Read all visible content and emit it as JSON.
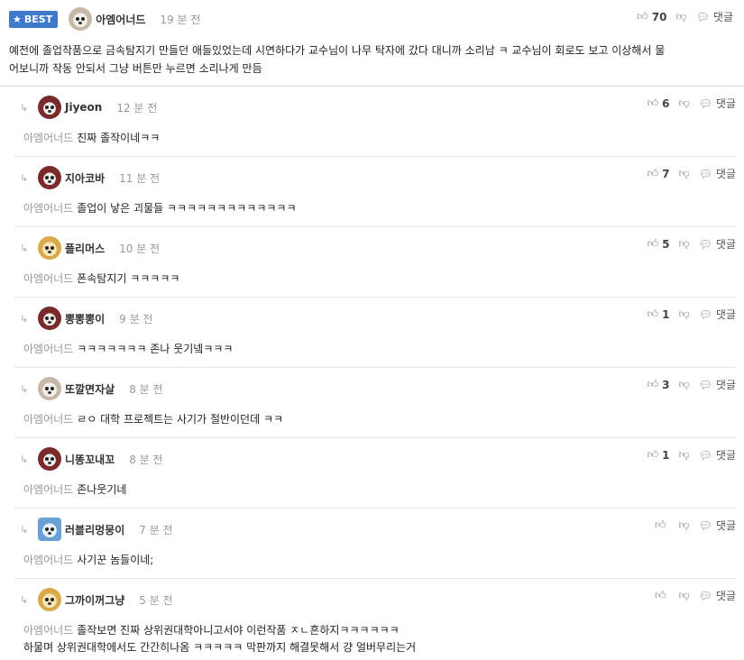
{
  "best": {
    "badge_label": "BEST",
    "nick": "아엠어너드",
    "time": "19 분 전",
    "likes": "70",
    "reply_label": "댓글",
    "text_line1": "예전에 졸업작품으로 금속탐지기 만들던 애들있었는데 시연하다가 교수님이 나무 탁자에 갔다 대니까 소리남 ㅋ 교수님이 회로도 보고 이상해서 물",
    "text_line2": "어보니까 작동 안되서 그냥 버튼만 누르면 소리나게 만듬"
  },
  "replies": [
    {
      "nick": "Jiyeon",
      "time": "12 분 전",
      "likes": "6",
      "reply_label": "댓글",
      "mention": "아엠어너드",
      "text": "진짜 졸작이네ㅋㅋ",
      "text2": "",
      "avatar": "dog-dark"
    },
    {
      "nick": "지아코바",
      "time": "11 분 전",
      "likes": "7",
      "reply_label": "댓글",
      "mention": "아엠어너드",
      "text": "졸업이 낳은 괴물들 ㅋㅋㅋㅋㅋㅋㅋㅋㅋㅋㅋㅋㅋ",
      "text2": "",
      "avatar": "dog-dark"
    },
    {
      "nick": "플리머스",
      "time": "10 분 전",
      "likes": "5",
      "reply_label": "댓글",
      "mention": "아엠어너드",
      "text": "폰속탐지기 ㅋㅋㅋㅋㅋ",
      "text2": "",
      "avatar": "dog-yellow"
    },
    {
      "nick": "뽕뽕뽕이",
      "time": "9 분 전",
      "likes": "1",
      "reply_label": "댓글",
      "mention": "아엠어너드",
      "text": "ㅋㅋㅋㅋㅋㅋㅋ 존나 웃기넼ㅋㅋㅋ",
      "text2": "",
      "avatar": "dog-dark"
    },
    {
      "nick": "또깔면자살",
      "time": "8 분 전",
      "likes": "3",
      "reply_label": "댓글",
      "mention": "아엠어너드",
      "text": "ㄹㅇ 대학 프로젝트는 사기가 절반이던데 ㅋㅋ",
      "text2": "",
      "avatar": "dog-white"
    },
    {
      "nick": "니똥꼬내꼬",
      "time": "8 분 전",
      "likes": "1",
      "reply_label": "댓글",
      "mention": "아엠어너드",
      "text": "존나웃기네",
      "text2": "",
      "avatar": "dog-dark"
    },
    {
      "nick": "러블리멍뭉이",
      "time": "7 분 전",
      "likes": "",
      "reply_label": "댓글",
      "mention": "아엠어너드",
      "text": "사기꾼 놈들이네;",
      "text2": "",
      "avatar": "dog-blue"
    },
    {
      "nick": "그까이꺼그냥",
      "time": "5 분 전",
      "likes": "",
      "reply_label": "댓글",
      "mention": "아엠어너드",
      "text": "졸작보면 진짜 상위권대학아니고서야 이런작품 ㅈㄴ흔하지ㅋㅋㅋㅋㅋㅋ",
      "text2": "하물며 상위권대학에서도 간간히나옴 ㅋㅋㅋㅋㅋ 막판까지 해결못해서 걍 얼버무리는거",
      "avatar": "dog-yellow"
    }
  ],
  "icons": {
    "like": "thumbs-up-icon",
    "dislike": "thumbs-down-icon",
    "reply": "speech-bubble-icon",
    "arrow": "reply-arrow-icon",
    "star": "star-icon"
  },
  "colors": {
    "badge": "#3f79c9",
    "muted": "#999999",
    "divider": "#e6e6e6"
  }
}
